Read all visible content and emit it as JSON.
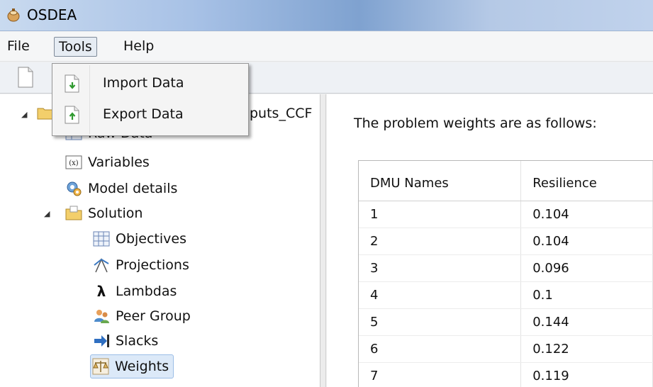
{
  "window": {
    "title": "OSDEA"
  },
  "menubar": {
    "items": [
      "File",
      "Tools",
      "Help"
    ]
  },
  "dropdown": {
    "items": [
      {
        "label": "Import Data",
        "icon": "import-data-icon"
      },
      {
        "label": "Export Data",
        "icon": "export-data-icon"
      }
    ]
  },
  "tree": {
    "root_label_partial": "puts_CCF",
    "items": [
      {
        "label": "Raw Data",
        "icon": "raw-data-icon"
      },
      {
        "label": "Variables",
        "icon": "variables-icon"
      },
      {
        "label": "Model details",
        "icon": "model-details-icon"
      },
      {
        "label": "Solution",
        "icon": "folder-icon"
      },
      {
        "label": "Objectives",
        "icon": "objectives-icon"
      },
      {
        "label": "Projections",
        "icon": "projections-icon"
      },
      {
        "label": "Lambdas",
        "icon": "lambda-icon"
      },
      {
        "label": "Peer Group",
        "icon": "peer-group-icon"
      },
      {
        "label": "Slacks",
        "icon": "slacks-icon"
      },
      {
        "label": "Weights",
        "icon": "weights-icon",
        "selected": true
      }
    ]
  },
  "content": {
    "caption": "The problem weights are as follows:",
    "table": {
      "headers": [
        "DMU Names",
        "Resilience"
      ],
      "rows": [
        [
          "1",
          "0.104"
        ],
        [
          "2",
          "0.104"
        ],
        [
          "3",
          "0.096"
        ],
        [
          "4",
          "0.1"
        ],
        [
          "5",
          "0.144"
        ],
        [
          "6",
          "0.122"
        ],
        [
          "7",
          "0.119"
        ]
      ]
    }
  },
  "colors": {
    "selection": "#dce9f8",
    "titlebar": "#a7c1e6",
    "menu_highlight": "#e6ecf3"
  }
}
